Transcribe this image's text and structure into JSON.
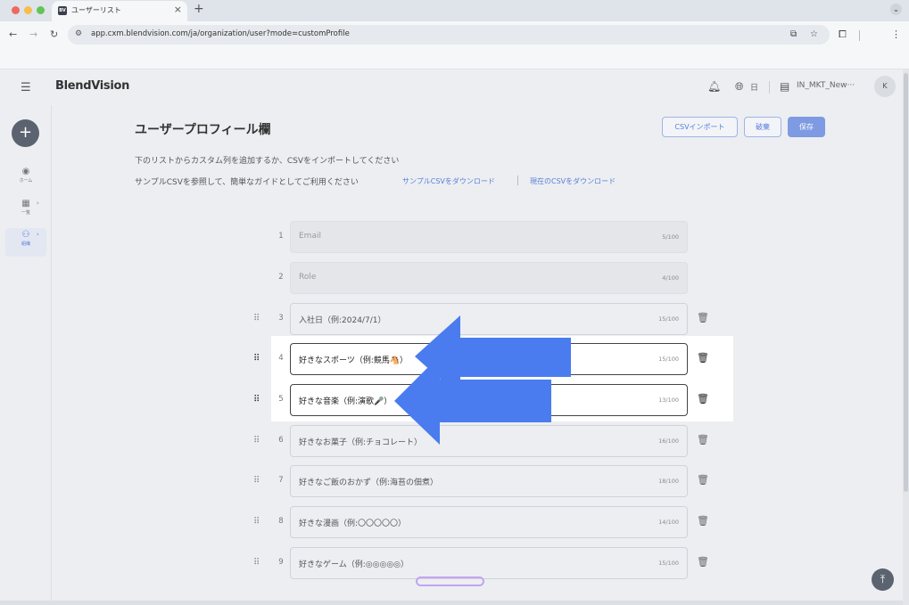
{
  "browser": {
    "tab_title": "ユーザーリスト",
    "tab_favicon": "BV",
    "url": "app.cxm.blendvision.com/ja/organization/user?mode=customProfile"
  },
  "header": {
    "logo": "BlendVision",
    "language": "日",
    "org_name": "IN_MKT_New···",
    "avatar_initial": "K"
  },
  "sidebar": {
    "items": [
      {
        "label": "ホーム"
      },
      {
        "label": "一覧"
      },
      {
        "label": "組織"
      }
    ]
  },
  "main": {
    "title": "ユーザープロフィール欄",
    "buttons": {
      "import": "CSVインポート",
      "discard": "破棄",
      "save": "保存"
    },
    "description_1": "下のリストからカスタム列を追加するか、CSVをインポートしてください",
    "description_2": "サンプルCSVを参照して、簡単なガイドとしてご利用ください",
    "link_sample": "サンプルCSVをダウンロード",
    "link_current": "現在のCSVをダウンロード",
    "fields": [
      {
        "num": "1",
        "value": "Email",
        "count": "5/100"
      },
      {
        "num": "2",
        "value": "Role",
        "count": "4/100"
      },
      {
        "num": "3",
        "value": "入社日（例:2024/7/1）",
        "count": "15/100"
      },
      {
        "num": "4",
        "value": "好きなスポーツ（例:競馬🐴）",
        "count": "15/100"
      },
      {
        "num": "5",
        "value": "好きな音楽（例:演歌🎤）",
        "count": "13/100"
      },
      {
        "num": "6",
        "value": "好きなお菓子（例:チョコレート）",
        "count": "16/100"
      },
      {
        "num": "7",
        "value": "好きなご飯のおかず（例:海苔の佃煮）",
        "count": "18/100"
      },
      {
        "num": "8",
        "value": "好きな漫画（例:〇〇〇〇〇）",
        "count": "14/100"
      },
      {
        "num": "9",
        "value": "好きなゲーム（例:◎◎◎◎◎）",
        "count": "15/100"
      }
    ]
  },
  "colors": {
    "accent": "#5a7fd9",
    "primary_button": "#7d9ae3",
    "arrow": "#4a7cf0"
  }
}
